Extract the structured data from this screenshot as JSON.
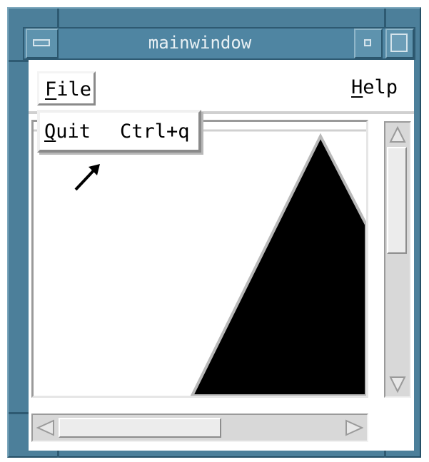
{
  "window": {
    "title": "mainwindow",
    "icons": {
      "window_menu": "window-menu-icon",
      "minimize": "minimize-icon",
      "maximize": "maximize-icon"
    }
  },
  "menubar": {
    "file": {
      "label": "File",
      "mnemonic": "F"
    },
    "help": {
      "label": "Help",
      "mnemonic": "H"
    }
  },
  "file_menu": {
    "items": [
      {
        "label": "Quit",
        "mnemonic": "Q",
        "accelerator": "Ctrl+q"
      }
    ]
  },
  "scrollbars": {
    "vertical": {
      "up_icon": "arrow-up-icon",
      "down_icon": "arrow-down-icon"
    },
    "horizontal": {
      "left_icon": "arrow-left-icon",
      "right_icon": "arrow-right-icon"
    }
  },
  "colors": {
    "frame": "#4c7f9a",
    "shape_fill": "#000000",
    "widget_gray": "#d8d8d8"
  }
}
